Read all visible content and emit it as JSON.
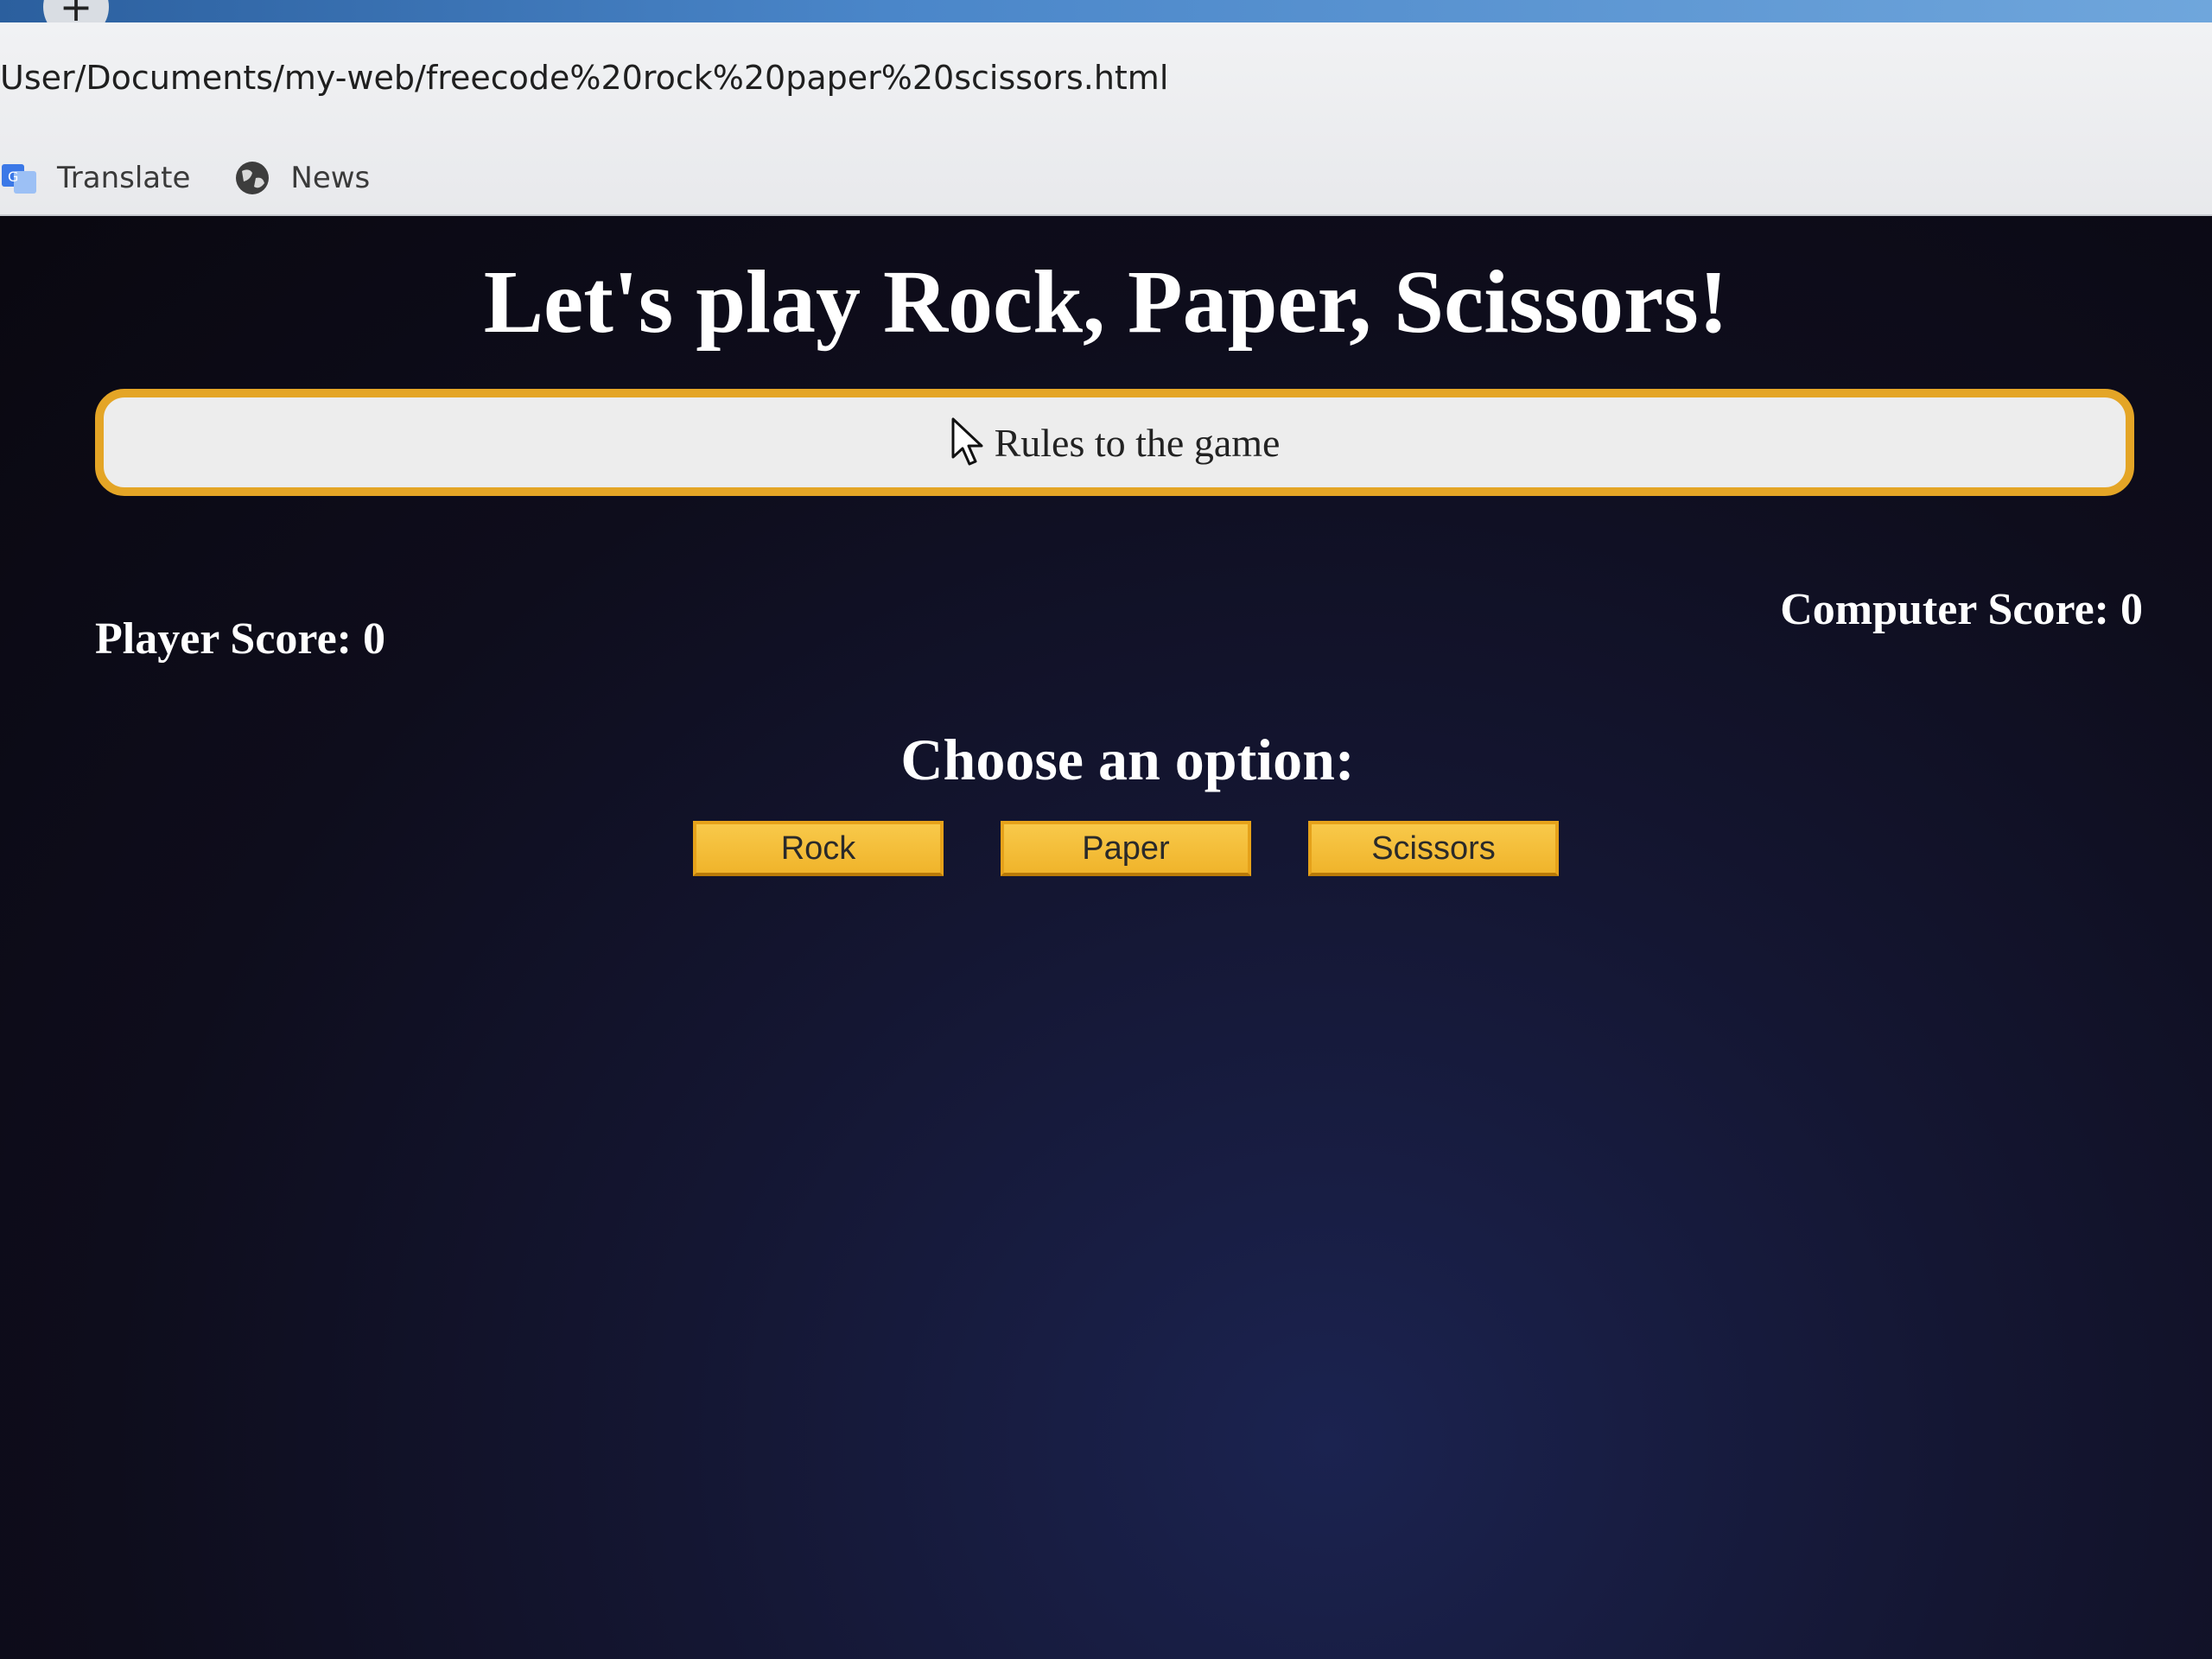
{
  "browser": {
    "new_tab_label": "+",
    "address": "User/Documents/my-web/freecode%20rock%20paper%20scissors.html",
    "bookmarks": [
      {
        "label": "Translate",
        "icon": "translate-icon"
      },
      {
        "label": "News",
        "icon": "globe-icon"
      }
    ]
  },
  "page": {
    "title": "Let's play Rock, Paper, Scissors!",
    "rules_label": "Rules to the game",
    "player_score_label": "Player Score: 0",
    "computer_score_label": "Computer Score: 0",
    "choose_label": "Choose an option:",
    "options": [
      {
        "label": "Rock"
      },
      {
        "label": "Paper"
      },
      {
        "label": "Scissors"
      }
    ]
  },
  "colors": {
    "page_background": "#0e0d1c",
    "accent": "#f0b42b",
    "rules_border": "#e4a526",
    "text": "#ffffff"
  }
}
